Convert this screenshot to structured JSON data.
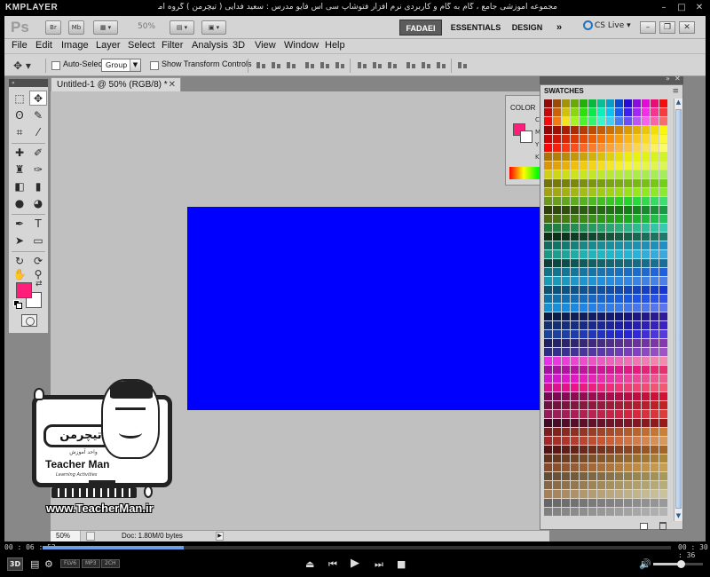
{
  "player": {
    "name": "KMPLAYER",
    "caption": "مجموعه آموزشی جامع ، گام به گام و کاربردی نرم افزار فتوشاپ سی اس فایو  مدرس : سعید فدایی ( تیچرمن ) گروه آموزشی پادشاه گرافیست ها",
    "minimize_icon": "minimize-icon",
    "maximize_icon": "maximize-icon",
    "close_icon": "close-icon",
    "time_current": "00 : 06 : 52",
    "time_total": "00 : 30 : 36",
    "progress": 0.225,
    "volume": 0.55,
    "badge_3d": "3D",
    "badges": [
      "FLV6",
      "MP3",
      "2CH"
    ]
  },
  "photoshop": {
    "logo": "Ps",
    "app_buttons": [
      "Br",
      "Mb"
    ],
    "zoom": "50%",
    "workspaces": [
      "FADAEI",
      "ESSENTIALS",
      "DESIGN",
      "»"
    ],
    "active_workspace": "FADAEI",
    "cs_live": "CS Live",
    "menu": [
      "File",
      "Edit",
      "Image",
      "Layer",
      "Select",
      "Filter",
      "Analysis",
      "3D",
      "View",
      "Window",
      "Help"
    ],
    "options": {
      "auto_select_label": "Auto-Select:",
      "auto_select_value": "Group",
      "show_transform_label": "Show Transform Controls"
    },
    "document": {
      "tab_title": "Untitled-1 @ 50% (RGB/8) *",
      "canvas_color": "#0000ff"
    },
    "foreground_color": "#ff1f7a",
    "color_panel": {
      "title": "COLOR",
      "letters": [
        "C",
        "M",
        "Y",
        "K"
      ]
    },
    "swatches_panel": {
      "title": "SWATCHES"
    },
    "status": {
      "zoom": "50%",
      "doc": "Doc: 1.80M/0 bytes"
    }
  },
  "watermark": {
    "brand_fa": "تیچرمن",
    "sub_fa": "واحد آموزش",
    "brand_en": "Teacher Man",
    "tagline": "Learning Activities",
    "url": "www.TeacherMan.ir"
  }
}
